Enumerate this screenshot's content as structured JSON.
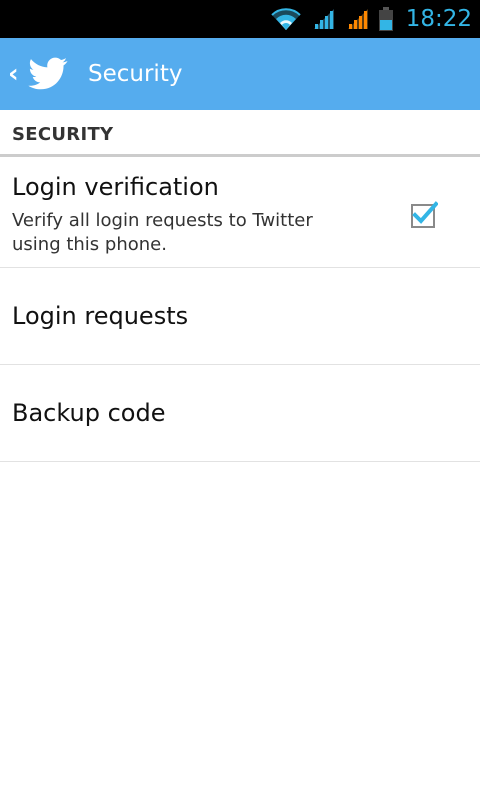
{
  "status_bar": {
    "time": "18:22",
    "icons": [
      "wifi-icon",
      "signal-icon",
      "signal-roaming-icon",
      "battery-icon"
    ],
    "accent_color": "#33b5e5",
    "roaming_color": "#ff8800"
  },
  "action_bar": {
    "title": "Security",
    "up_icon": "chevron-left-icon",
    "app_icon": "twitter-bird-icon",
    "color": "#55acee"
  },
  "section": {
    "header": "SECURITY"
  },
  "preferences": [
    {
      "title": "Login verification",
      "summary": "Verify all login requests to Twitter using this phone.",
      "checked": true
    },
    {
      "title": "Login requests"
    },
    {
      "title": "Backup code"
    }
  ]
}
